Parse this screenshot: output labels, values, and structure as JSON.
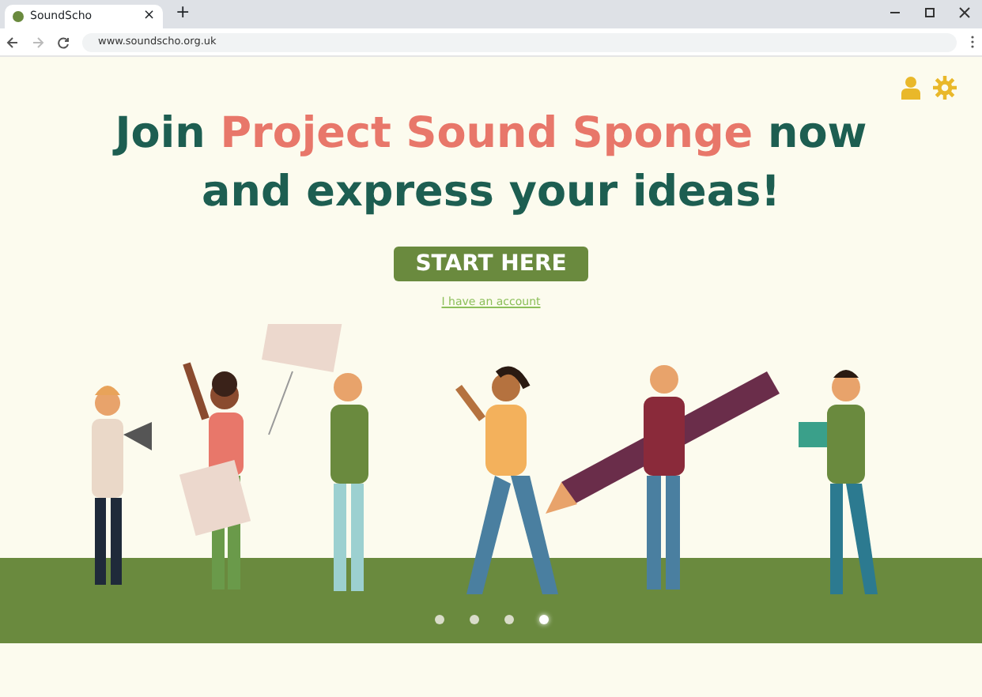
{
  "browser": {
    "tabs": [
      {
        "title": "SoundScho",
        "selected": true
      }
    ],
    "new_tab": "+",
    "close_tab": "×",
    "address": "www.soundscho.org.uk"
  },
  "headline": [
    {
      "text": "Join ",
      "accent": false
    },
    {
      "text": "Project Sound Sponge",
      "accent": true
    },
    {
      "text": " now",
      "accent": false
    }
  ],
  "headline_line_2": "and express your ideas!",
  "start_button": "START HERE",
  "account_link": "I have an account",
  "carousel_dots": [
    {
      "selected": false
    },
    {
      "selected": false
    },
    {
      "selected": false
    },
    {
      "selected": true
    }
  ]
}
